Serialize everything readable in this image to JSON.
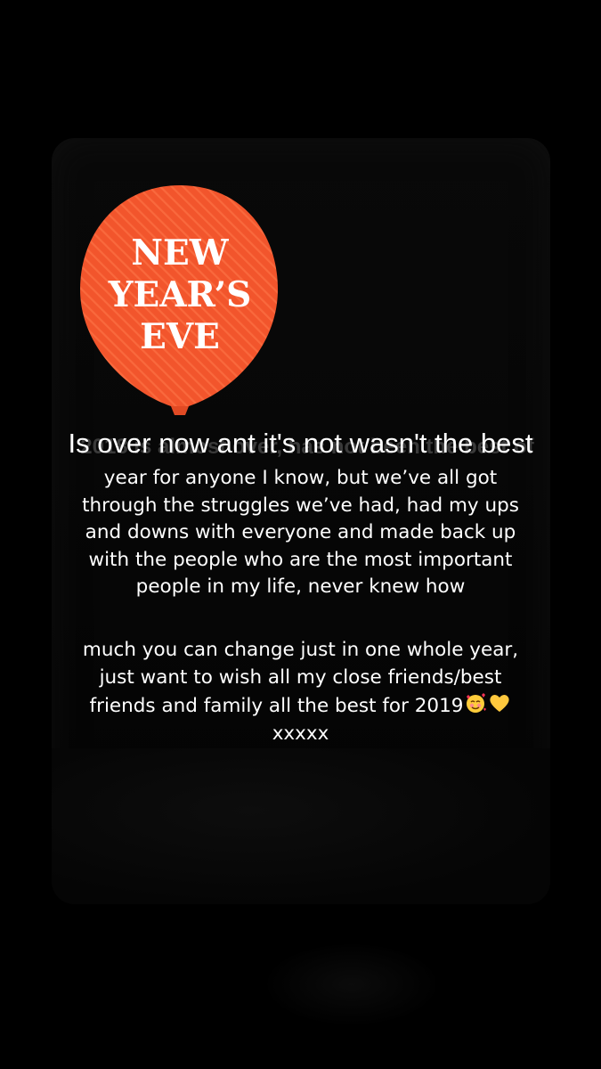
{
  "background_color": "#000000",
  "balloon": {
    "color": "#f2552c",
    "line1": "NEW",
    "line2": "YEAR’S",
    "line3": "EVE"
  },
  "ghost_caption": "2018 is almost over, has not been the best of",
  "overlay_text": "Is over now ant it's not wasn't the best",
  "caption": {
    "paragraph1": [
      "year for anyone I know, but we’ve all got",
      "through the struggles we’ve had, had my ups",
      "and downs with everyone and made back up",
      "with the people who are the most important",
      "people in my life, never knew how"
    ],
    "paragraph2": [
      "much you can change just in one whole year,",
      "just want to wish all my close friends/best",
      "friends and family all the best for 2019",
      "xxxxx"
    ]
  },
  "emoji": {
    "smiling_face_with_hearts": "🥰",
    "yellow_heart": "💛"
  }
}
